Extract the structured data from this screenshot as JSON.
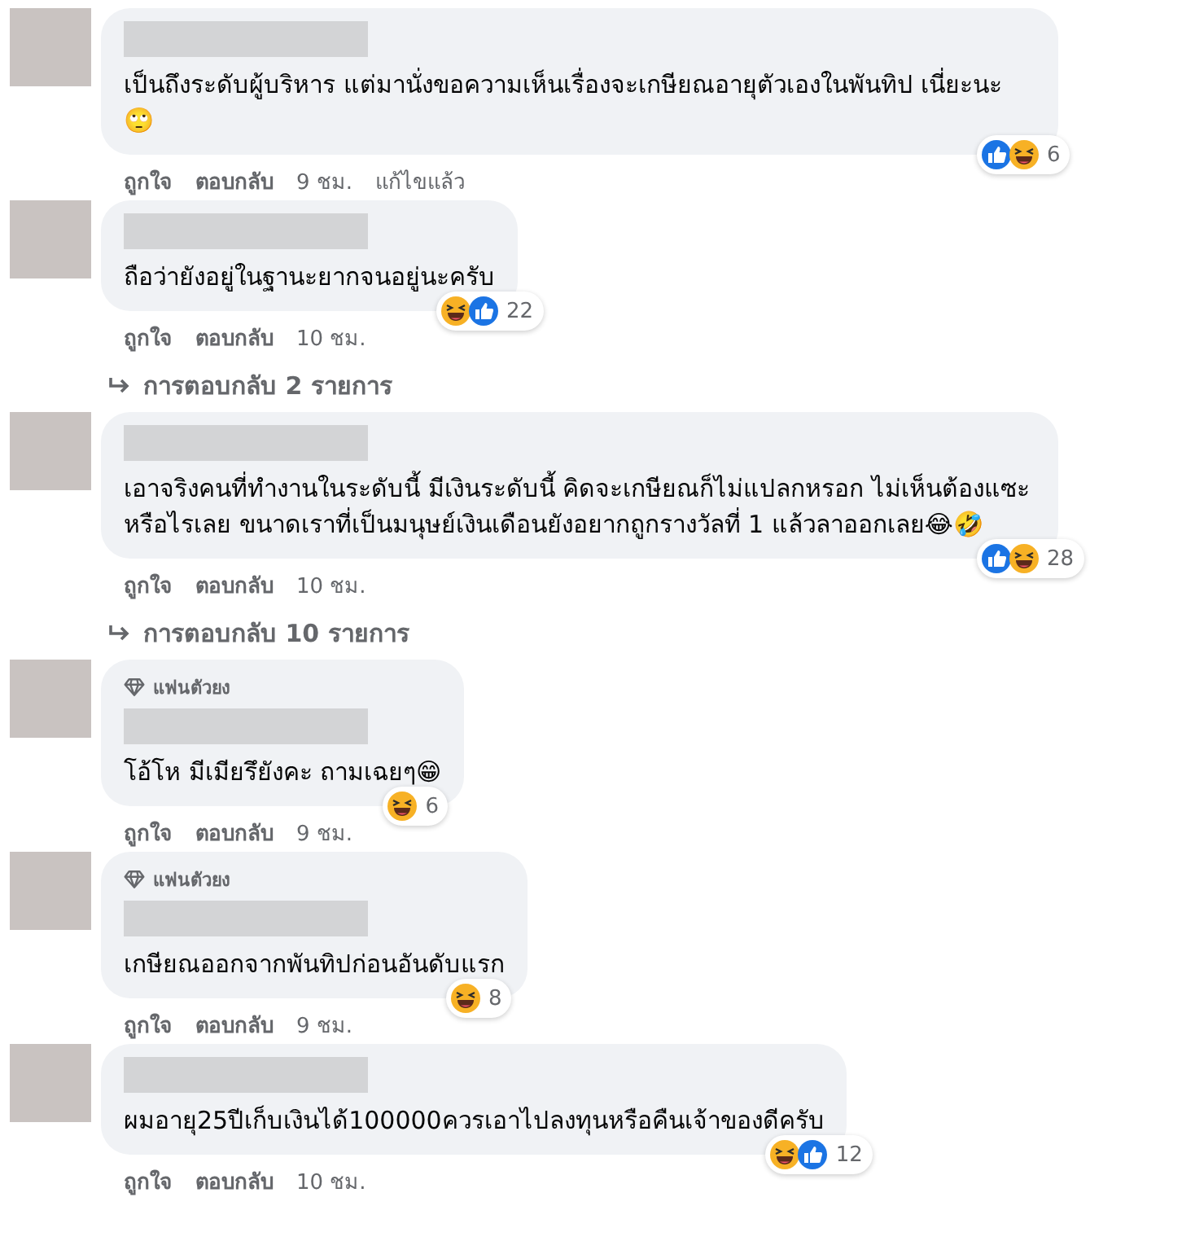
{
  "comments": [
    {
      "text": "เป็นถึงระดับผู้บริหาร แต่มานั่งขอความเห็นเรื่องจะเกษียณอายุตัวเองในพันทิป เนี่ยะนะ 🙄",
      "reactions": [
        {
          "kind": "like"
        },
        {
          "kind": "haha"
        }
      ],
      "reaction_count": "6",
      "like_label": "ถูกใจ",
      "reply_label": "ตอบกลับ",
      "time": "9 ชม.",
      "edited": "แก้ไขแล้ว"
    },
    {
      "text": "ถือว่ายังอยู่ในฐานะยากจนอยู่นะครับ",
      "reactions": [
        {
          "kind": "haha"
        },
        {
          "kind": "like"
        }
      ],
      "reaction_count": "22",
      "like_label": "ถูกใจ",
      "reply_label": "ตอบกลับ",
      "time": "10 ชม.",
      "replies_link": "การตอบกลับ 2 รายการ"
    },
    {
      "text": "เอาจริงคนที่ทำงานในระดับนี้ มีเงินระดับนี้ คิดจะเกษียณก็ไม่แปลกหรอก ไม่เห็นต้องแซะหรือไรเลย ขนาดเราที่เป็นมนุษย์เงินเดือนยังอยากถูกรางวัลที่ 1 แล้วลาออกเลย😂🤣",
      "reactions": [
        {
          "kind": "like"
        },
        {
          "kind": "haha"
        }
      ],
      "reaction_count": "28",
      "like_label": "ถูกใจ",
      "reply_label": "ตอบกลับ",
      "time": "10 ชม.",
      "replies_link": "การตอบกลับ 10 รายการ"
    },
    {
      "badge": "แฟนตัวยง",
      "text": "โอ้โห มีเมียรึยังคะ ถามเฉยๆ😁",
      "reactions": [
        {
          "kind": "haha"
        }
      ],
      "reaction_count": "6",
      "like_label": "ถูกใจ",
      "reply_label": "ตอบกลับ",
      "time": "9 ชม."
    },
    {
      "badge": "แฟนตัวยง",
      "text": "เกษียณออกจากพันทิปก่อนอันดับแรก",
      "reactions": [
        {
          "kind": "haha"
        }
      ],
      "reaction_count": "8",
      "like_label": "ถูกใจ",
      "reply_label": "ตอบกลับ",
      "time": "9 ชม."
    },
    {
      "text": "ผมอายุ25ปีเก็บเงินได้100000ควรเอาไปลงทุนหรือคืนเจ้าของดีครับ",
      "reactions": [
        {
          "kind": "haha"
        },
        {
          "kind": "like"
        }
      ],
      "reaction_count": "12",
      "like_label": "ถูกใจ",
      "reply_label": "ตอบกลับ",
      "time": "10 ชม."
    }
  ]
}
